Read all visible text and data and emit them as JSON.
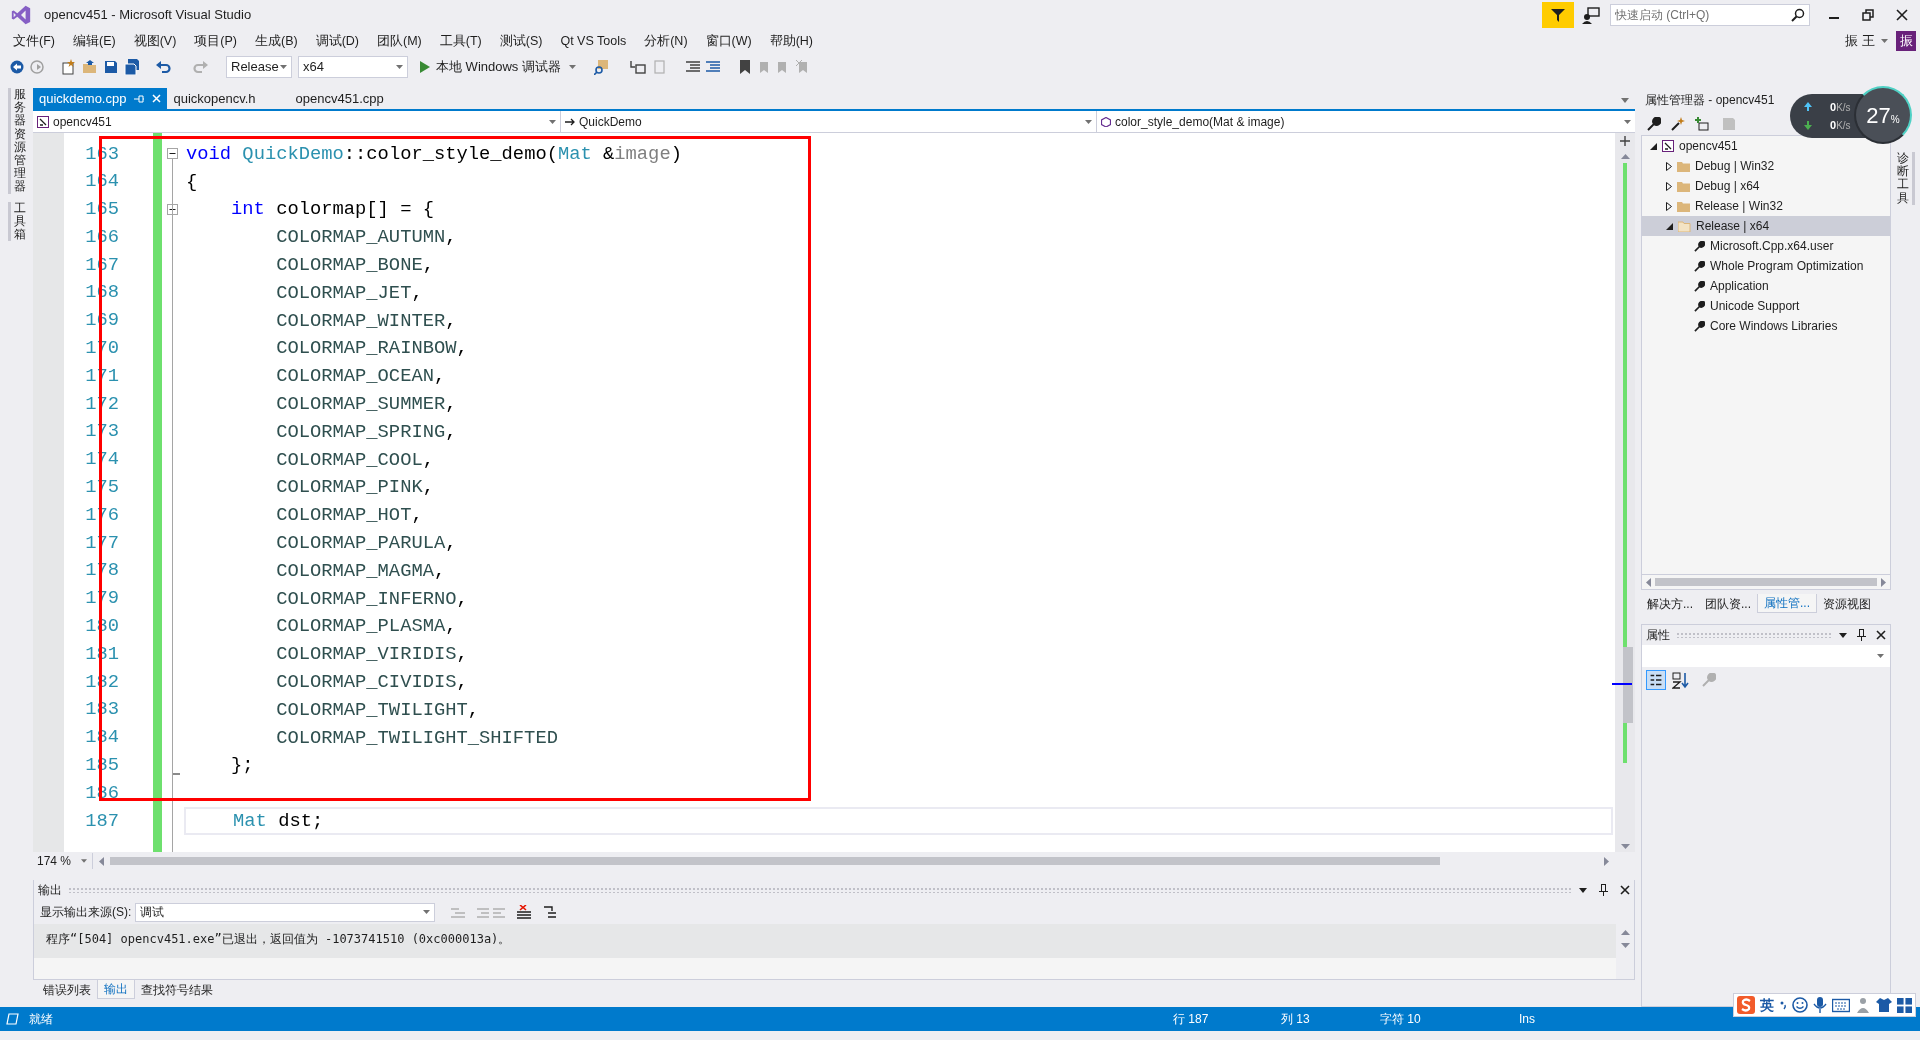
{
  "window": {
    "title": "opencv451 - Microsoft Visual Studio"
  },
  "quick_launch": {
    "placeholder": "快速启动 (Ctrl+Q)"
  },
  "user": {
    "name": "振 王",
    "avatar": "振"
  },
  "menu": [
    "文件(F)",
    "编辑(E)",
    "视图(V)",
    "项目(P)",
    "生成(B)",
    "调试(D)",
    "团队(M)",
    "工具(T)",
    "测试(S)",
    "Qt VS Tools",
    "分析(N)",
    "窗口(W)",
    "帮助(H)"
  ],
  "toolbar": {
    "configuration": "Release",
    "platform": "x64",
    "debugger": "本地 Windows 调试器"
  },
  "left_strip": [
    {
      "label": "服务器资源管理器"
    },
    {
      "label": "工具箱"
    }
  ],
  "right_strip": [
    {
      "label": "诊断工具"
    }
  ],
  "document_tabs": [
    {
      "label": "quickdemo.cpp",
      "selected": true
    },
    {
      "label": "quickopencv.h",
      "selected": false
    },
    {
      "label": "opencv451.cpp",
      "selected": false
    }
  ],
  "navigation": {
    "project": "opencv451",
    "scope": "QuickDemo",
    "member": "color_style_demo(Mat & image)"
  },
  "editor": {
    "zoom": "174 %",
    "lines": [
      {
        "number": "163",
        "collapsible": true,
        "block_end": false,
        "current": false,
        "tokens": [
          {
            "kind": "keyword",
            "text": "void "
          },
          {
            "kind": "type",
            "text": "QuickDemo"
          },
          {
            "kind": "plain",
            "text": "::color_style_demo("
          },
          {
            "kind": "type",
            "text": "Mat"
          },
          {
            "kind": "plain",
            "text": " &"
          },
          {
            "kind": "param",
            "text": "image"
          },
          {
            "kind": "plain",
            "text": ")"
          }
        ]
      },
      {
        "number": "164",
        "collapsible": false,
        "block_end": false,
        "current": false,
        "tokens": [
          {
            "kind": "plain",
            "text": "{"
          }
        ]
      },
      {
        "number": "165",
        "collapsible": true,
        "block_end": false,
        "current": false,
        "tokens": [
          {
            "kind": "keyword",
            "text": "    int"
          },
          {
            "kind": "plain",
            "text": " colormap[] = {"
          }
        ]
      },
      {
        "number": "166",
        "collapsible": false,
        "block_end": false,
        "current": false,
        "tokens": [
          {
            "kind": "enum",
            "text": "        COLORMAP_AUTUMN"
          },
          {
            "kind": "plain",
            "text": ","
          }
        ]
      },
      {
        "number": "167",
        "collapsible": false,
        "block_end": false,
        "current": false,
        "tokens": [
          {
            "kind": "enum",
            "text": "        COLORMAP_BONE"
          },
          {
            "kind": "plain",
            "text": ","
          }
        ]
      },
      {
        "number": "168",
        "collapsible": false,
        "block_end": false,
        "current": false,
        "tokens": [
          {
            "kind": "enum",
            "text": "        COLORMAP_JET"
          },
          {
            "kind": "plain",
            "text": ","
          }
        ]
      },
      {
        "number": "169",
        "collapsible": false,
        "block_end": false,
        "current": false,
        "tokens": [
          {
            "kind": "enum",
            "text": "        COLORMAP_WINTER"
          },
          {
            "kind": "plain",
            "text": ","
          }
        ]
      },
      {
        "number": "170",
        "collapsible": false,
        "block_end": false,
        "current": false,
        "tokens": [
          {
            "kind": "enum",
            "text": "        COLORMAP_RAINBOW"
          },
          {
            "kind": "plain",
            "text": ","
          }
        ]
      },
      {
        "number": "171",
        "collapsible": false,
        "block_end": false,
        "current": false,
        "tokens": [
          {
            "kind": "enum",
            "text": "        COLORMAP_OCEAN"
          },
          {
            "kind": "plain",
            "text": ","
          }
        ]
      },
      {
        "number": "172",
        "collapsible": false,
        "block_end": false,
        "current": false,
        "tokens": [
          {
            "kind": "enum",
            "text": "        COLORMAP_SUMMER"
          },
          {
            "kind": "plain",
            "text": ","
          }
        ]
      },
      {
        "number": "173",
        "collapsible": false,
        "block_end": false,
        "current": false,
        "tokens": [
          {
            "kind": "enum",
            "text": "        COLORMAP_SPRING"
          },
          {
            "kind": "plain",
            "text": ","
          }
        ]
      },
      {
        "number": "174",
        "collapsible": false,
        "block_end": false,
        "current": false,
        "tokens": [
          {
            "kind": "enum",
            "text": "        COLORMAP_COOL"
          },
          {
            "kind": "plain",
            "text": ","
          }
        ]
      },
      {
        "number": "175",
        "collapsible": false,
        "block_end": false,
        "current": false,
        "tokens": [
          {
            "kind": "enum",
            "text": "        COLORMAP_PINK"
          },
          {
            "kind": "plain",
            "text": ","
          }
        ]
      },
      {
        "number": "176",
        "collapsible": false,
        "block_end": false,
        "current": false,
        "tokens": [
          {
            "kind": "enum",
            "text": "        COLORMAP_HOT"
          },
          {
            "kind": "plain",
            "text": ","
          }
        ]
      },
      {
        "number": "177",
        "collapsible": false,
        "block_end": false,
        "current": false,
        "tokens": [
          {
            "kind": "enum",
            "text": "        COLORMAP_PARULA"
          },
          {
            "kind": "plain",
            "text": ","
          }
        ]
      },
      {
        "number": "178",
        "collapsible": false,
        "block_end": false,
        "current": false,
        "tokens": [
          {
            "kind": "enum",
            "text": "        COLORMAP_MAGMA"
          },
          {
            "kind": "plain",
            "text": ","
          }
        ]
      },
      {
        "number": "179",
        "collapsible": false,
        "block_end": false,
        "current": false,
        "tokens": [
          {
            "kind": "enum",
            "text": "        COLORMAP_INFERNO"
          },
          {
            "kind": "plain",
            "text": ","
          }
        ]
      },
      {
        "number": "180",
        "collapsible": false,
        "block_end": false,
        "current": false,
        "tokens": [
          {
            "kind": "enum",
            "text": "        COLORMAP_PLASMA"
          },
          {
            "kind": "plain",
            "text": ","
          }
        ]
      },
      {
        "number": "181",
        "collapsible": false,
        "block_end": false,
        "current": false,
        "tokens": [
          {
            "kind": "enum",
            "text": "        COLORMAP_VIRIDIS"
          },
          {
            "kind": "plain",
            "text": ","
          }
        ]
      },
      {
        "number": "182",
        "collapsible": false,
        "block_end": false,
        "current": false,
        "tokens": [
          {
            "kind": "enum",
            "text": "        COLORMAP_CIVIDIS"
          },
          {
            "kind": "plain",
            "text": ","
          }
        ]
      },
      {
        "number": "183",
        "collapsible": false,
        "block_end": false,
        "current": false,
        "tokens": [
          {
            "kind": "enum",
            "text": "        COLORMAP_TWILIGHT"
          },
          {
            "kind": "plain",
            "text": ","
          }
        ]
      },
      {
        "number": "184",
        "collapsible": false,
        "block_end": false,
        "current": false,
        "tokens": [
          {
            "kind": "enum",
            "text": "        COLORMAP_TWILIGHT_SHIFTED"
          }
        ]
      },
      {
        "number": "185",
        "collapsible": false,
        "block_end": true,
        "current": false,
        "tokens": [
          {
            "kind": "plain",
            "text": "    };"
          }
        ]
      },
      {
        "number": "186",
        "collapsible": false,
        "block_end": false,
        "current": false
      },
      {
        "number": "187",
        "collapsible": false,
        "block_end": false,
        "current": true,
        "tokens": [
          {
            "kind": "type",
            "text": "    Mat"
          },
          {
            "kind": "plain",
            "text": " dst;"
          }
        ]
      }
    ]
  },
  "properties_manager": {
    "title": "属性管理器 - opencv451",
    "tree": [
      {
        "label": "opencv451",
        "kind": "project",
        "expanded": true,
        "selected": false,
        "children": [
          {
            "label": "Debug | Win32",
            "kind": "folder",
            "expanded": false,
            "selected": false
          },
          {
            "label": "Debug | x64",
            "kind": "folder",
            "expanded": false,
            "selected": false
          },
          {
            "label": "Release | Win32",
            "kind": "folder",
            "expanded": false,
            "selected": false
          },
          {
            "label": "Release | x64",
            "kind": "folder",
            "expanded": true,
            "selected": true,
            "children": [
              {
                "label": "Microsoft.Cpp.x64.user",
                "kind": "sheet",
                "selected": false
              },
              {
                "label": "Whole Program Optimization",
                "kind": "sheet",
                "selected": false
              },
              {
                "label": "Application",
                "kind": "sheet",
                "selected": false
              },
              {
                "label": "Unicode Support",
                "kind": "sheet",
                "selected": false
              },
              {
                "label": "Core Windows Libraries",
                "kind": "sheet",
                "selected": false
              }
            ]
          }
        ]
      }
    ]
  },
  "network_widget": {
    "upload": {
      "value": "0",
      "unit": "K/s"
    },
    "download": {
      "value": "0",
      "unit": "K/s"
    },
    "usage": "27",
    "usage_unit": "%"
  },
  "panel_tabs": [
    {
      "label": "解决方...",
      "selected": false
    },
    {
      "label": "团队资...",
      "selected": false
    },
    {
      "label": "属性管...",
      "selected": true
    },
    {
      "label": "资源视图",
      "selected": false
    }
  ],
  "properties": {
    "title": "属性"
  },
  "output": {
    "title": "输出",
    "source_label": "显示输出来源(S):",
    "source": "调试",
    "lines": [
      "程序“[504] opencv451.exe”已退出，返回值为 -1073741510 (0xc000013a)。"
    ]
  },
  "bottom_tabs": [
    {
      "label": "错误列表",
      "selected": false
    },
    {
      "label": "输出",
      "selected": true
    },
    {
      "label": "查找符号结果",
      "selected": false
    }
  ],
  "status_bar": {
    "message": "就绪",
    "line": "行 187",
    "column": "列 13",
    "char": "字符 10",
    "mode": "Ins"
  },
  "ime_toolbar": {
    "language": "英"
  }
}
